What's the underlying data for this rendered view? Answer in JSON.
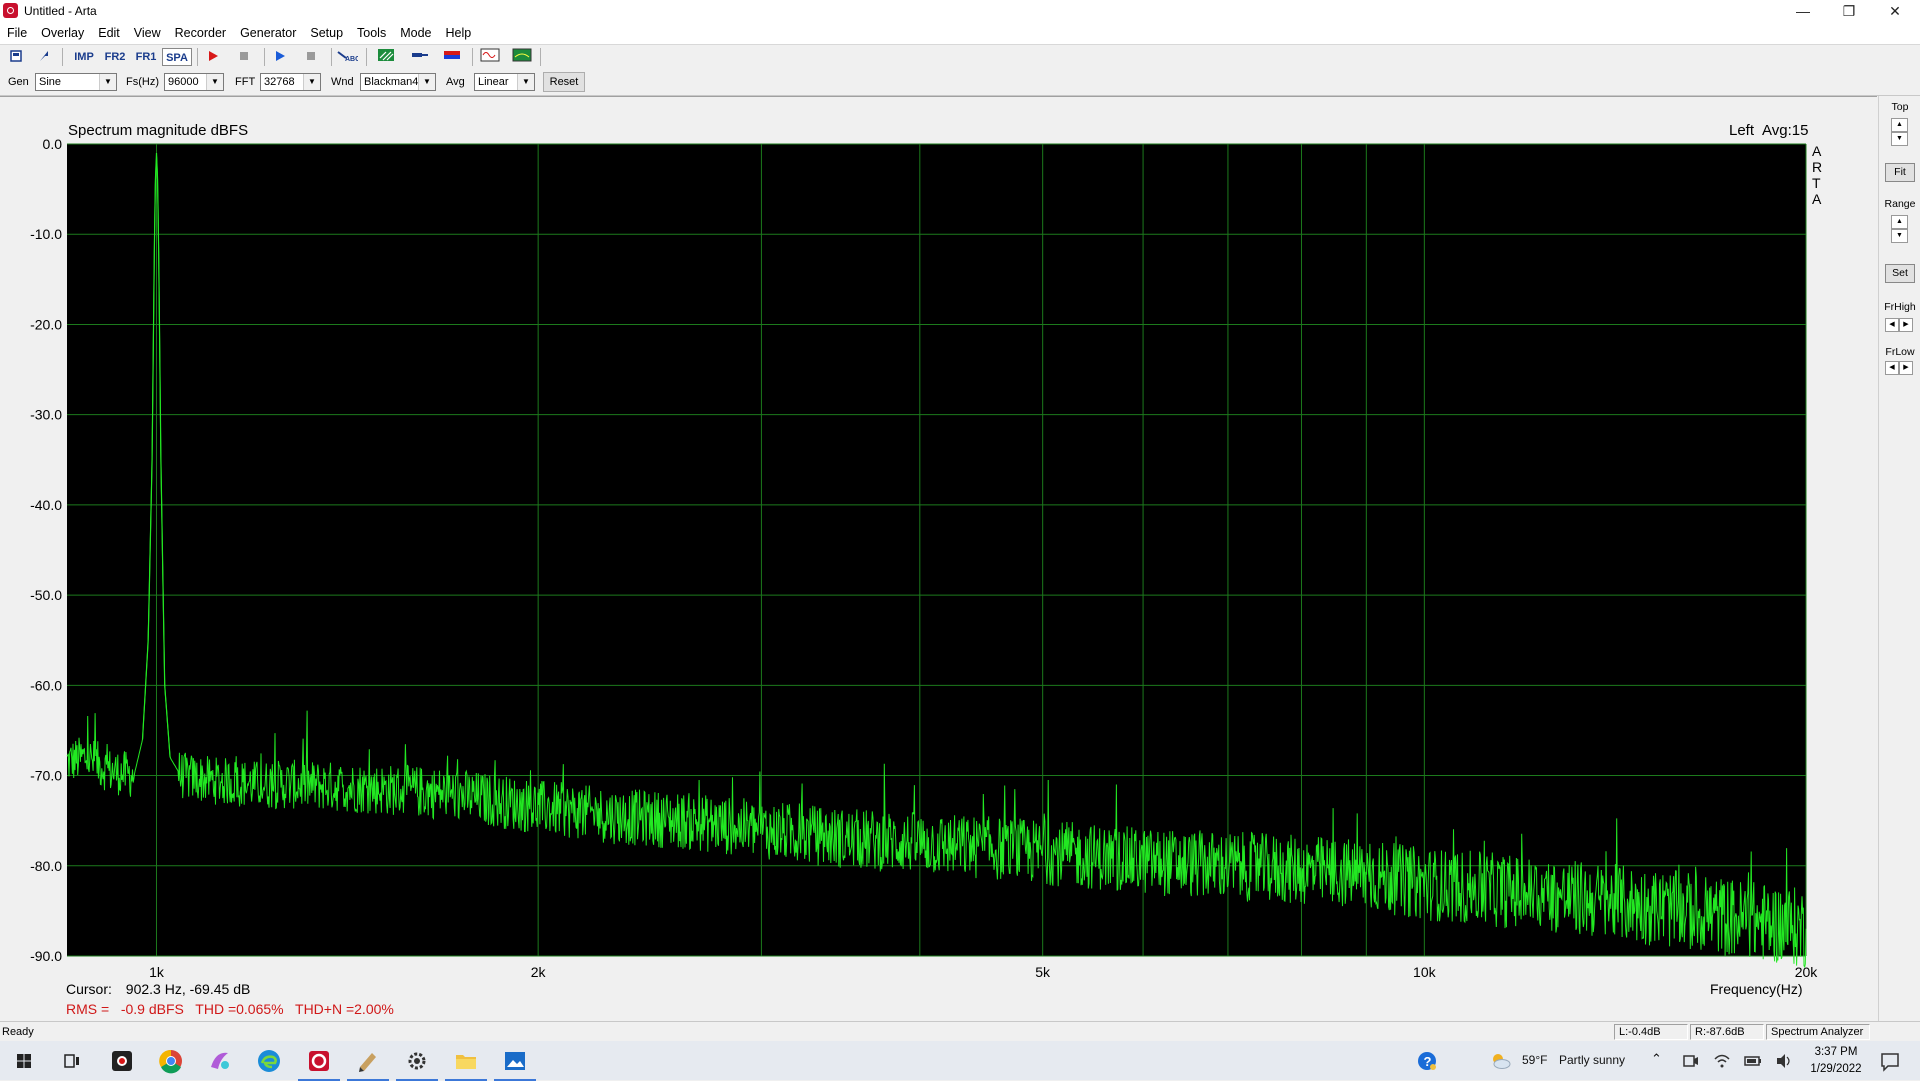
{
  "window": {
    "title": "Untitled - Arta"
  },
  "menu": [
    "File",
    "Overlay",
    "Edit",
    "View",
    "Recorder",
    "Generator",
    "Setup",
    "Tools",
    "Mode",
    "Help"
  ],
  "toolbar": {
    "buttons": [
      "new-icon",
      "open-icon",
      "Imp",
      "Fr2",
      "Fr1",
      "Spa",
      "record-icon",
      "stop-icon",
      "play-icon",
      "stop-icon",
      "abc-icon",
      "waterfall-icon",
      "cable-icon",
      "level-icon",
      "oscilloscope-icon",
      "meter-icon"
    ],
    "imp_label": "IMP",
    "fr2_label": "FR2",
    "fr1_label": "FR1",
    "spa_label": "SPA"
  },
  "controls": {
    "gen_label": "Gen",
    "gen_value": "Sine",
    "fs_label": "Fs(Hz)",
    "fs_value": "96000",
    "fft_label": "FFT",
    "fft_value": "32768",
    "wnd_label": "Wnd",
    "wnd_value": "Blackman4",
    "avg_label": "Avg",
    "avg_value": "Linear",
    "reset_label": "Reset"
  },
  "plot": {
    "title": "Spectrum magnitude dBFS",
    "channel": "Left",
    "avg": "Avg:15",
    "brand_letters": [
      "A",
      "R",
      "T",
      "A"
    ],
    "cursor_label": "Cursor:",
    "cursor_value": "902.3 Hz, -69.45 dB",
    "stats": "RMS =   -0.9 dBFS   THD =0.065%   THD+N =2.00%",
    "xlabel": "Frequency(Hz)"
  },
  "chart_data": {
    "type": "line",
    "title": "Spectrum magnitude dBFS",
    "xlabel": "Frequency(Hz)",
    "ylabel": "",
    "xscale": "log",
    "xlim": [
      850,
      20000
    ],
    "ylim": [
      -90,
      0
    ],
    "grid": true,
    "background": "#000000",
    "line_color": "#22e822",
    "grid_color": "#1c7a1c",
    "yticks": [
      "0.0",
      "-10.0",
      "-20.0",
      "-30.0",
      "-40.0",
      "-50.0",
      "-60.0",
      "-70.0",
      "-80.0",
      "-90.0"
    ],
    "xticks": [
      {
        "value": 1000,
        "label": "1k"
      },
      {
        "value": 2000,
        "label": "2k"
      },
      {
        "value": 5000,
        "label": "5k"
      },
      {
        "value": 10000,
        "label": "10k"
      },
      {
        "value": 20000,
        "label": "20k"
      }
    ],
    "series": [
      {
        "x": [
          850,
          880,
          920,
          960,
          975,
          985,
          992,
          996,
          998,
          1000,
          1002,
          1004,
          1008,
          1015,
          1025,
          1045,
          1100,
          1200,
          1300,
          1500,
          1700,
          2000,
          2300,
          2600,
          3000,
          3500,
          4000,
          4500,
          5000,
          5500,
          6000,
          7000,
          8000,
          9000,
          10000,
          11000,
          12000,
          13000,
          14000,
          15000,
          16000,
          17000,
          18000,
          19000,
          20000
        ],
        "y": [
          -68.5,
          -68.0,
          -69.5,
          -70.0,
          -66.0,
          -55.0,
          -35.0,
          -12.0,
          -4.0,
          -1.0,
          -4.0,
          -12.0,
          -35.0,
          -60.0,
          -68.0,
          -70.0,
          -70.5,
          -71.0,
          -71.0,
          -71.5,
          -72.0,
          -73.5,
          -74.5,
          -75.0,
          -76.0,
          -77.0,
          -77.5,
          -78.0,
          -78.5,
          -79.0,
          -79.5,
          -80.0,
          -80.5,
          -81.0,
          -82.0,
          -82.5,
          -83.0,
          -83.5,
          -84.0,
          -84.5,
          -85.0,
          -85.5,
          -86.0,
          -86.5,
          -87.0
        ]
      }
    ]
  },
  "right_panel": {
    "top_label": "Top",
    "fit_label": "Fit",
    "range_label": "Range",
    "set_label": "Set",
    "frhigh_label": "FrHigh",
    "frlow_label": "FrLow"
  },
  "status": {
    "ready": "Ready",
    "left": "L:-0.4dB",
    "right": "R:-87.6dB",
    "mode": "Spectrum Analyzer"
  },
  "taskbar": {
    "weather_temp": "59°F",
    "weather_text": "Partly sunny",
    "time": "3:37 PM",
    "date": "1/29/2022"
  }
}
